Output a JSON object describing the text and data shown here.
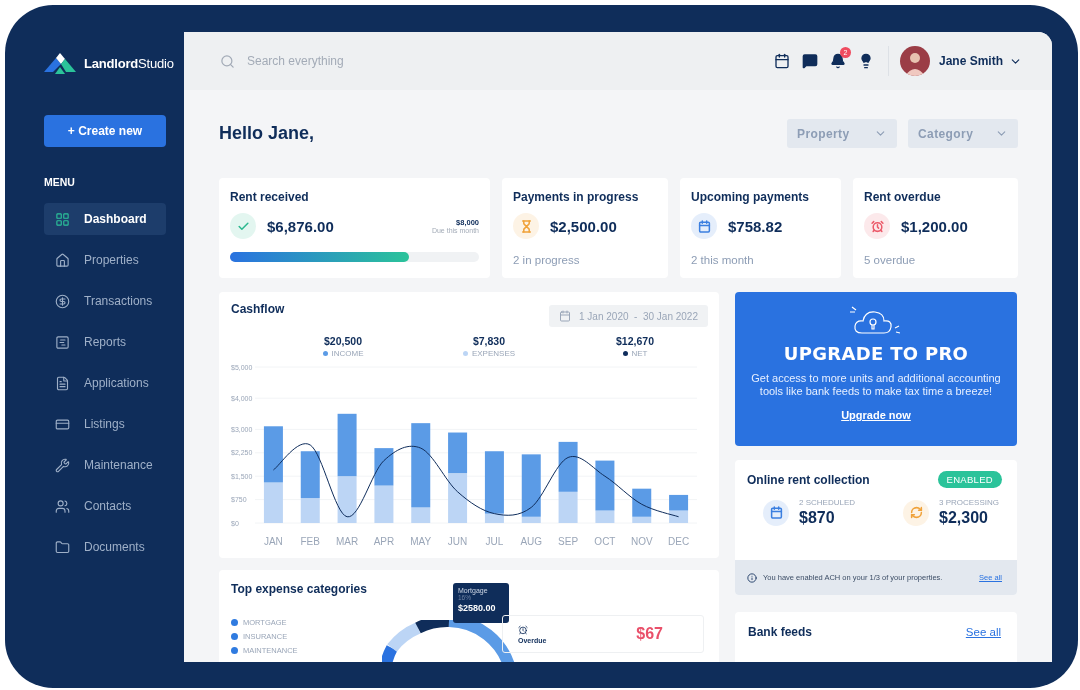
{
  "brand": {
    "name": "**Landlord**Studio"
  },
  "create_button": {
    "label": "+ Create new"
  },
  "menu": {
    "heading": "MENU",
    "items": [
      {
        "label": "Dashboard",
        "selected": true
      },
      {
        "label": "Properties",
        "selected": false
      },
      {
        "label": "Transactions",
        "selected": false
      },
      {
        "label": "Reports",
        "selected": false
      },
      {
        "label": "Applications",
        "selected": false
      },
      {
        "label": "Listings",
        "selected": false
      },
      {
        "label": "Maintenance",
        "selected": false
      },
      {
        "label": "Contacts",
        "selected": false
      },
      {
        "label": "Documents",
        "selected": false
      }
    ]
  },
  "search": {
    "placeholder": "Search everything"
  },
  "notifications": {
    "count": "2"
  },
  "user": {
    "name": "Jane Smith"
  },
  "greeting": "Hello Jane,",
  "filters": [
    {
      "label": "Property"
    },
    {
      "label": "Category"
    }
  ],
  "stat_cards": [
    {
      "kind": "progress",
      "title": "Rent received",
      "amount": "$6,876.00",
      "target": "$8,000",
      "target_note": "Due this month",
      "level": 0.72,
      "color": "#2bb88f"
    },
    {
      "kind": "count",
      "title": "Payments in progress",
      "amount": "$2,500.00",
      "note": "2 in progress",
      "color": "#f0a23a"
    },
    {
      "kind": "count",
      "title": "Upcoming payments",
      "amount": "$758.82",
      "note": "2 this month",
      "color": "#3b7fe0"
    },
    {
      "kind": "count",
      "title": "Rent overdue",
      "amount": "$1,200.00",
      "note": "5 overdue",
      "color": "#ec5a6a"
    }
  ],
  "cashflow": {
    "title": "Cashflow",
    "date_range": "1 Jan 2020  -  30 Jan 2022",
    "summary": [
      {
        "value": "$20,500"
      },
      {
        "value": "$7,830"
      },
      {
        "value": "$12,670"
      }
    ],
    "chart_data": {
      "type": "bar",
      "stacked": true,
      "categories": [
        "JAN",
        "FEB",
        "MAR",
        "APR",
        "MAY",
        "JUN",
        "JUL",
        "AUG",
        "SEP",
        "OCT",
        "NOV",
        "DEC"
      ],
      "ylim": [
        0,
        5000
      ],
      "grid": true,
      "yticks": [
        {
          "value": 0,
          "label": "$0"
        },
        {
          "value": 750,
          "label": "$750"
        },
        {
          "value": 1500,
          "label": "$1,500"
        },
        {
          "value": 2250,
          "label": "$2,250"
        },
        {
          "value": 3000,
          "label": "$3,000"
        },
        {
          "value": 4000,
          "label": "$4,000"
        },
        {
          "value": 5000,
          "label": "$5,000"
        }
      ],
      "series": [
        {
          "name": "INCOME",
          "type": "bar",
          "color": "#5b9be6",
          "values": [
            1800,
            1500,
            2000,
            1200,
            2700,
            1300,
            2000,
            2000,
            1600,
            1600,
            900,
            500
          ]
        },
        {
          "name": "EXPENSES",
          "type": "bar",
          "color": "#bcd5f5",
          "values": [
            1300,
            800,
            1500,
            1200,
            500,
            1600,
            300,
            200,
            1000,
            400,
            200,
            400
          ]
        },
        {
          "name": "NET",
          "type": "line",
          "color": "#0f2d5c",
          "values": [
            1700,
            2500,
            200,
            2000,
            2400,
            1000,
            300,
            500,
            2100,
            1500,
            600,
            200
          ]
        }
      ]
    }
  },
  "upgrade": {
    "title": "UPGRADE TO PRO",
    "text": "Get access to more units and additional accounting tools like bank feeds to make tax time a breeze!",
    "link": "Upgrade now"
  },
  "rent_collection": {
    "title": "Online rent collection",
    "badge": "ENABLED",
    "enabled": true,
    "items": [
      {
        "label": "2 SCHEDULED",
        "amount": "$870",
        "color": "#3b7fe0"
      },
      {
        "label": "3 PROCESSING",
        "amount": "$2,300",
        "color": "#f0a23a"
      }
    ],
    "info": "You have enabled ACH on your 1/3 of your properties.",
    "info_link": "See all"
  },
  "expenses": {
    "title": "Top expense categories",
    "legend": [
      "MORTGAGE",
      "INSURANCE",
      "MAINTENANCE"
    ],
    "tooltip": {
      "name": "Mortgage",
      "share": "16%",
      "amount": "$2580.00"
    },
    "overdue": {
      "label": "Overdue",
      "amount": "$67"
    }
  },
  "bank_feeds": {
    "title": "Bank feeds",
    "link": "See all"
  }
}
